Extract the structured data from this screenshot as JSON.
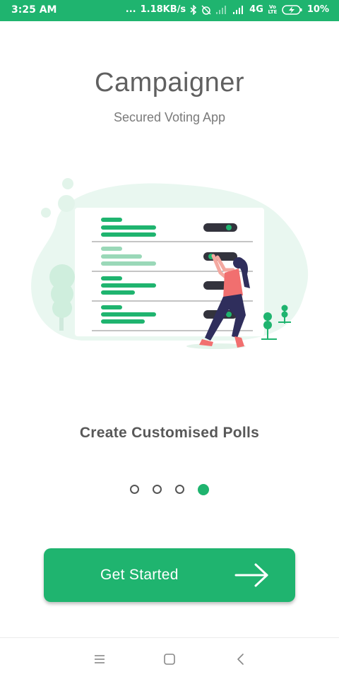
{
  "status_bar": {
    "time": "3:25 AM",
    "dots": "...",
    "net_speed": "1.18KB/s",
    "network": "4G",
    "volte": "Vo LTE",
    "battery": "10%"
  },
  "app": {
    "title": "Campaigner",
    "subtitle": "Secured Voting App"
  },
  "onboarding": {
    "caption": "Create Customised Polls",
    "pages": 4,
    "active_page": 4
  },
  "cta": {
    "label": "Get Started"
  },
  "colors": {
    "accent": "#1fb46f",
    "light_accent": "#e7f6ee",
    "toggle_dark": "#33333d",
    "figure_top": "#f16f6f",
    "figure_pants": "#2f2e5c"
  },
  "icons": {
    "bluetooth": "bluetooth-icon",
    "alarm": "alarm-off-icon",
    "signal": "signal-icon",
    "battery": "battery-charging-icon",
    "arrow": "arrow-right-icon",
    "nav_menu": "menu-icon",
    "nav_home": "home-square-icon",
    "nav_back": "back-chevron-icon"
  }
}
